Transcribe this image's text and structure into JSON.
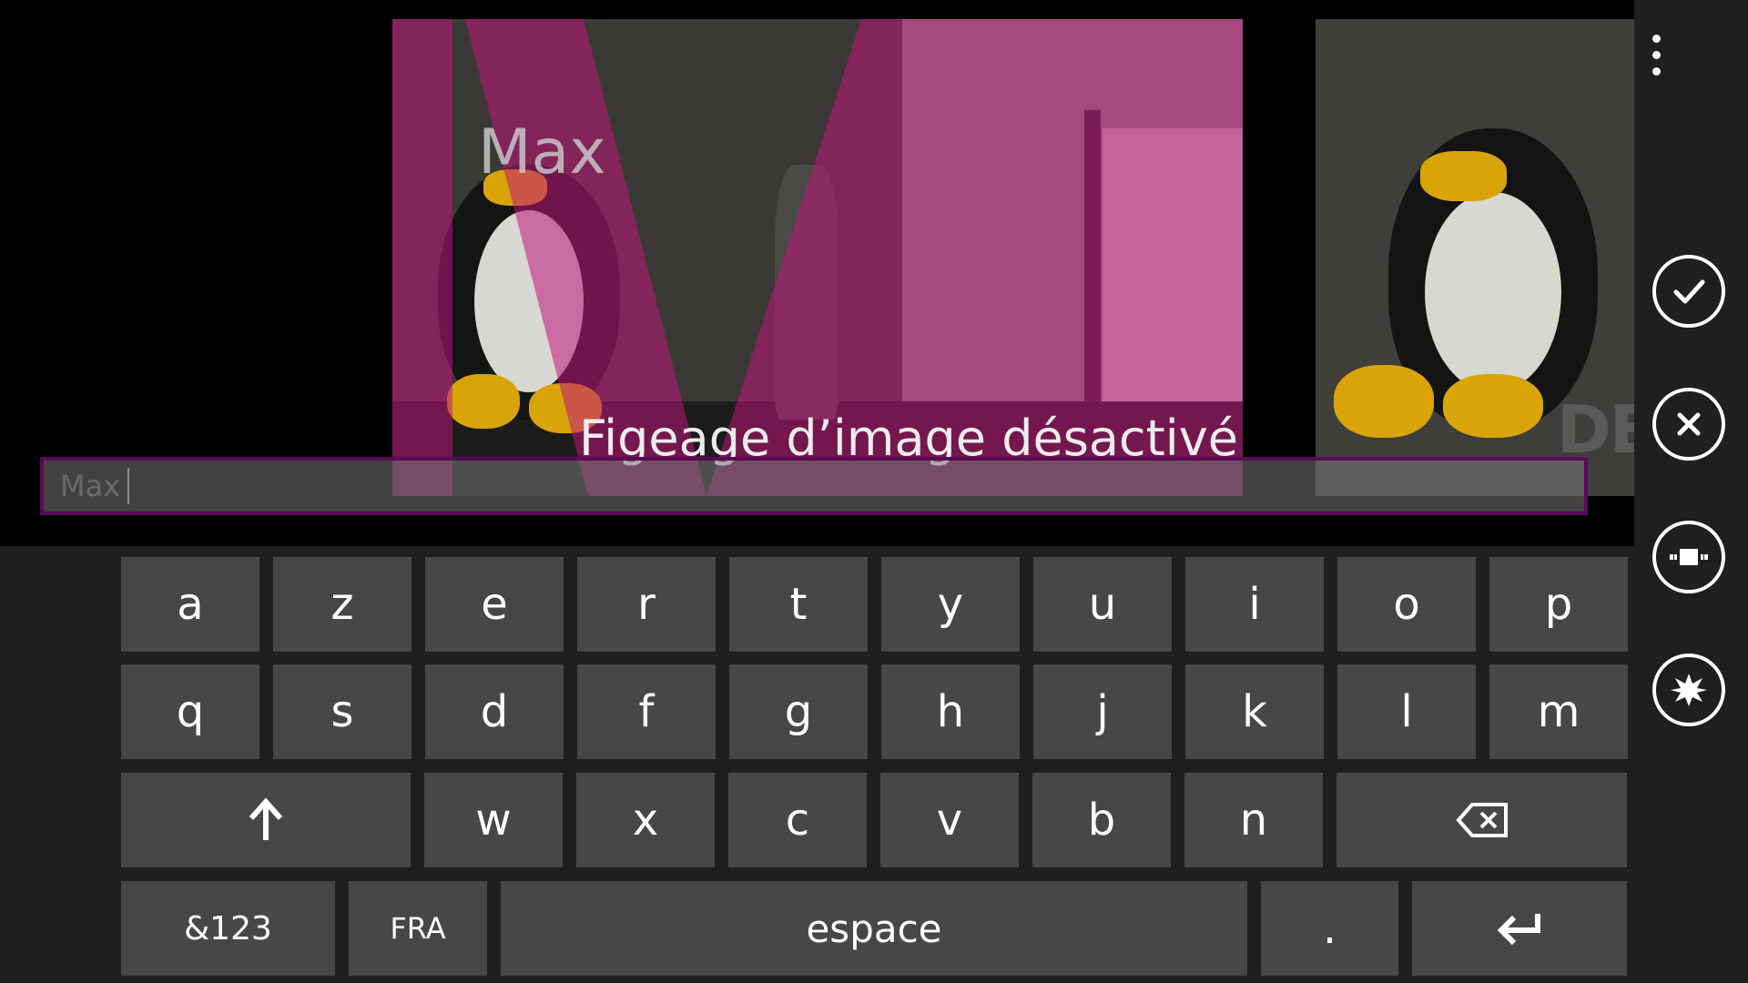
{
  "overlay": {
    "name_watermark": "Max",
    "corner_text": "DEI",
    "status_message": "Figeage d’image désactivé"
  },
  "name_field": {
    "value": "Max"
  },
  "appbar": {
    "more_icon": "more-vertical-icon",
    "buttons": [
      {
        "name": "accept",
        "icon": "checkmark-icon"
      },
      {
        "name": "cancel",
        "icon": "close-icon"
      },
      {
        "name": "focus",
        "icon": "focus-icon"
      },
      {
        "name": "flash",
        "icon": "burst-icon"
      }
    ]
  },
  "keyboard": {
    "row1": [
      "a",
      "z",
      "e",
      "r",
      "t",
      "y",
      "u",
      "i",
      "o",
      "p"
    ],
    "row2": [
      "q",
      "s",
      "d",
      "f",
      "g",
      "h",
      "j",
      "k",
      "l",
      "m"
    ],
    "row3": [
      "w",
      "x",
      "c",
      "v",
      "b",
      "n"
    ],
    "symbols_label": "&123",
    "language_label": "FRA",
    "space_label": "espace",
    "period_label": ".",
    "shift_icon": "arrow-up-icon",
    "backspace_icon": "backspace-icon",
    "enter_icon": "enter-icon"
  },
  "colors": {
    "overlay_magenta": "#c0147a",
    "input_border": "#5a0a5a",
    "key_bg": "#474747",
    "keyboard_bg": "#1f1f1f"
  }
}
